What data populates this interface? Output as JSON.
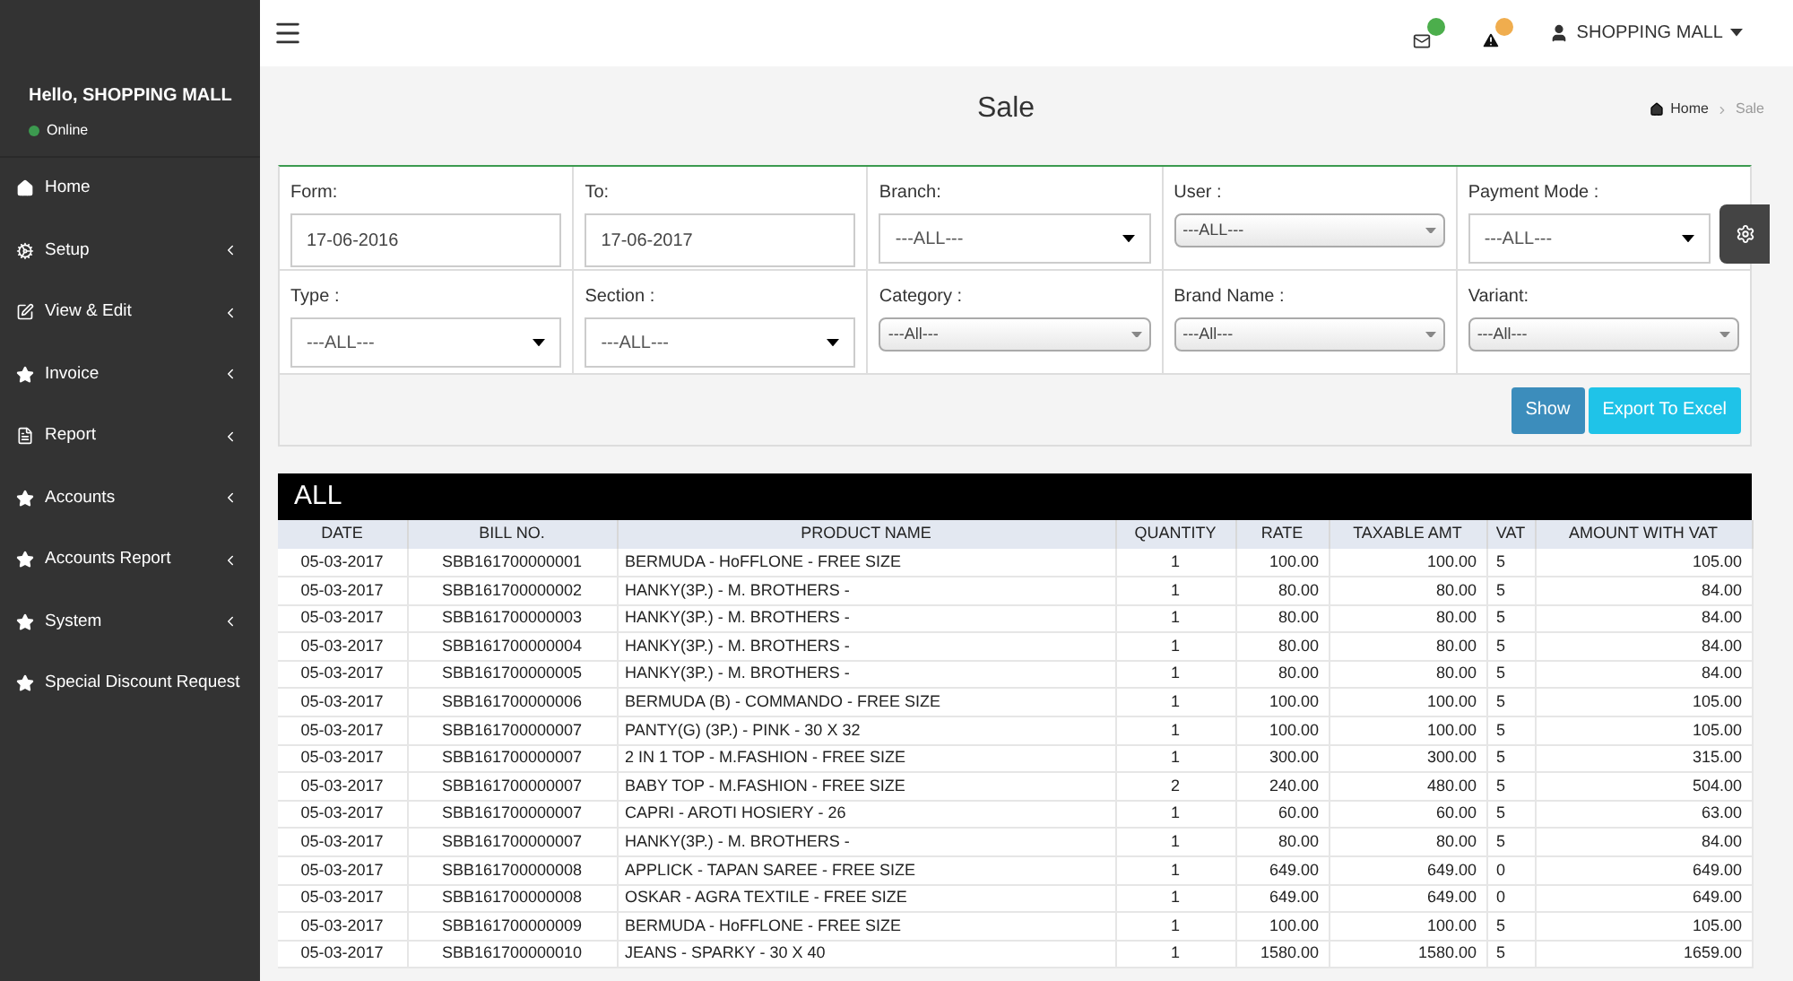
{
  "sidebar": {
    "greeting": "Hello, SHOPPING MALL",
    "status": "Online",
    "online": true,
    "items": [
      {
        "label": "Home",
        "kind": "home",
        "has_submenu": false
      },
      {
        "label": "Setup",
        "kind": "cogs",
        "has_submenu": true
      },
      {
        "label": "View & Edit",
        "kind": "edit",
        "has_submenu": true
      },
      {
        "label": "Invoice",
        "kind": "star",
        "has_submenu": true
      },
      {
        "label": "Report",
        "kind": "file",
        "has_submenu": true
      },
      {
        "label": "Accounts",
        "kind": "star",
        "has_submenu": true
      },
      {
        "label": "Accounts Report",
        "kind": "star",
        "has_submenu": true
      },
      {
        "label": "System",
        "kind": "star",
        "has_submenu": true
      },
      {
        "label": "Special Discount Request",
        "kind": "star",
        "has_submenu": false
      }
    ]
  },
  "topbar": {
    "user": "SHOPPING MALL"
  },
  "page": {
    "title": "Sale",
    "breadcrumb": [
      "Home",
      "Sale"
    ]
  },
  "filters": [
    {
      "label": "Form:",
      "kind": "text",
      "value": "17-06-2016"
    },
    {
      "label": "To:",
      "kind": "text",
      "value": "17-06-2017"
    },
    {
      "label": "Branch:",
      "kind": "native",
      "value": "---ALL---"
    },
    {
      "label": "User :",
      "kind": "styled",
      "value": "---ALL---"
    },
    {
      "label": "Payment Mode :",
      "kind": "native",
      "value": "---ALL---"
    },
    {
      "label": "Type :",
      "kind": "native",
      "value": "---ALL---"
    },
    {
      "label": "Section :",
      "kind": "native",
      "value": "---ALL---"
    },
    {
      "label": "Category :",
      "kind": "styled",
      "value": "---All---"
    },
    {
      "label": "Brand Name :",
      "kind": "styled",
      "value": "---All---"
    },
    {
      "label": "Variant:",
      "kind": "styled",
      "value": "---All---"
    }
  ],
  "buttons": [
    "Show",
    "Export To Excel"
  ],
  "table": {
    "title": "ALL",
    "columns": [
      "DATE",
      "BILL NO.",
      "PRODUCT NAME",
      "QUANTITY",
      "RATE",
      "TAXABLE AMT",
      "VAT",
      "AMOUNT WITH VAT"
    ],
    "rows": [
      [
        "05-03-2017",
        "SBB161700000001",
        "BERMUDA - HoFFLONE - FREE SIZE",
        "1",
        "100.00",
        "100.00",
        "5",
        "105.00"
      ],
      [
        "05-03-2017",
        "SBB161700000002",
        "HANKY(3P.) - M. BROTHERS -",
        "1",
        "80.00",
        "80.00",
        "5",
        "84.00"
      ],
      [
        "05-03-2017",
        "SBB161700000003",
        "HANKY(3P.) - M. BROTHERS -",
        "1",
        "80.00",
        "80.00",
        "5",
        "84.00"
      ],
      [
        "05-03-2017",
        "SBB161700000004",
        "HANKY(3P.) - M. BROTHERS -",
        "1",
        "80.00",
        "80.00",
        "5",
        "84.00"
      ],
      [
        "05-03-2017",
        "SBB161700000005",
        "HANKY(3P.) - M. BROTHERS -",
        "1",
        "80.00",
        "80.00",
        "5",
        "84.00"
      ],
      [
        "05-03-2017",
        "SBB161700000006",
        "BERMUDA (B) - COMMANDO - FREE SIZE",
        "1",
        "100.00",
        "100.00",
        "5",
        "105.00"
      ],
      [
        "05-03-2017",
        "SBB161700000007",
        "PANTY(G) (3P.) - PINK - 30 X 32",
        "1",
        "100.00",
        "100.00",
        "5",
        "105.00"
      ],
      [
        "05-03-2017",
        "SBB161700000007",
        "2 IN 1 TOP - M.FASHION - FREE SIZE",
        "1",
        "300.00",
        "300.00",
        "5",
        "315.00"
      ],
      [
        "05-03-2017",
        "SBB161700000007",
        "BABY TOP - M.FASHION - FREE SIZE",
        "2",
        "240.00",
        "480.00",
        "5",
        "504.00"
      ],
      [
        "05-03-2017",
        "SBB161700000007",
        "CAPRI - AROTI HOSIERY - 26",
        "1",
        "60.00",
        "60.00",
        "5",
        "63.00"
      ],
      [
        "05-03-2017",
        "SBB161700000007",
        "HANKY(3P.) - M. BROTHERS -",
        "1",
        "80.00",
        "80.00",
        "5",
        "84.00"
      ],
      [
        "05-03-2017",
        "SBB161700000008",
        "APPLICK - TAPAN SAREE - FREE SIZE",
        "1",
        "649.00",
        "649.00",
        "0",
        "649.00"
      ],
      [
        "05-03-2017",
        "SBB161700000008",
        "OSKAR - AGRA TEXTILE - FREE SIZE",
        "1",
        "649.00",
        "649.00",
        "0",
        "649.00"
      ],
      [
        "05-03-2017",
        "SBB161700000009",
        "BERMUDA - HoFFLONE - FREE SIZE",
        "1",
        "100.00",
        "100.00",
        "5",
        "105.00"
      ],
      [
        "05-03-2017",
        "SBB161700000010",
        "JEANS - SPARKY - 30 X 40",
        "1",
        "1580.00",
        "1580.00",
        "5",
        "1659.00"
      ]
    ]
  }
}
